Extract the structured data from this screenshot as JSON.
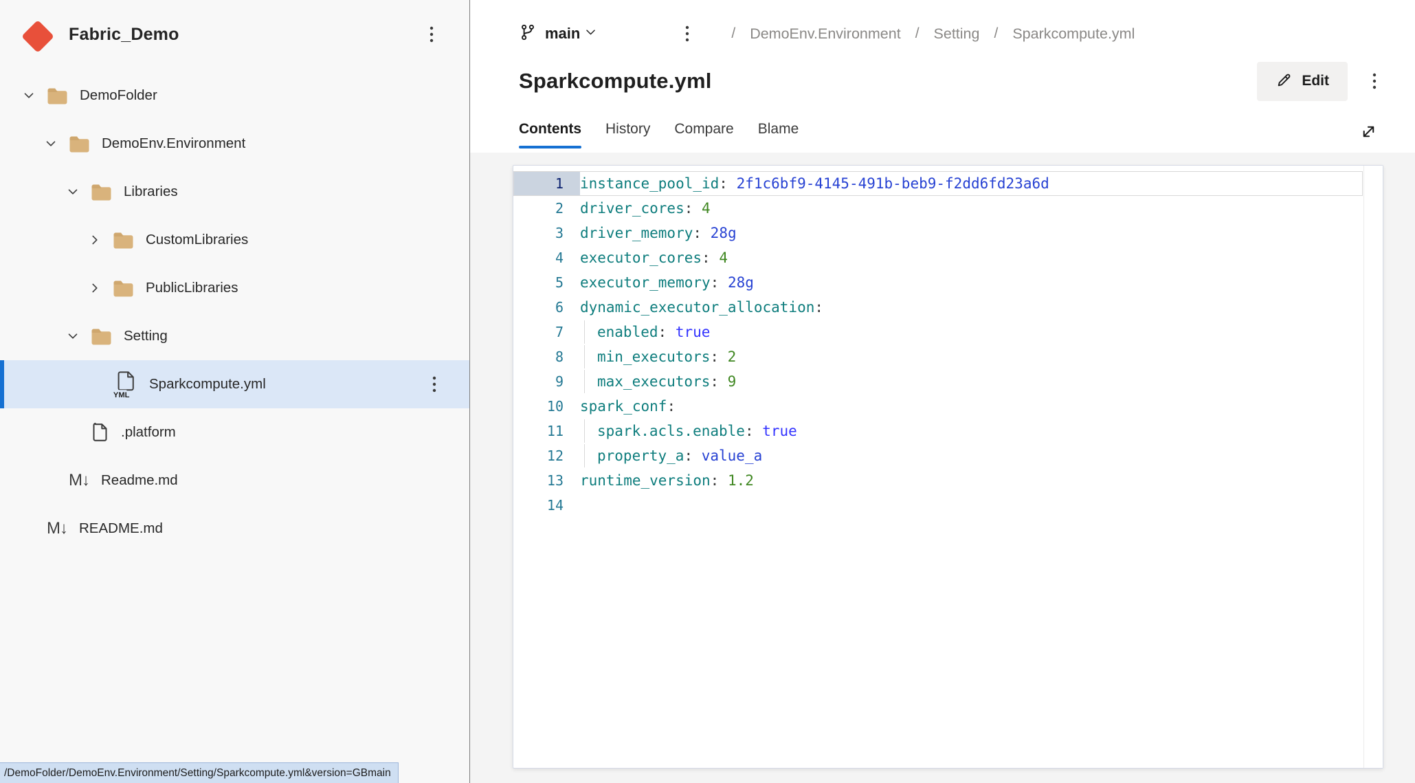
{
  "colors": {
    "accent_blue": "#1570d2",
    "selected_row_bg": "#dbe7f7",
    "selected_row_bar": "#1570cf",
    "repo_icon_red": "#e8503a",
    "folder_tan": "#d9b37c",
    "status_bar_bg": "#cfdff2",
    "token_key": "#0e7d7d",
    "token_string": "#2742d3",
    "token_boolean": "#3333ff",
    "token_number": "#3f8721",
    "token_default": "#3b3b3b",
    "line_number": "#237893",
    "line_number_active": "#0b216f"
  },
  "icons": {
    "repo": "git-fork",
    "branch": "git-branch",
    "kebab": "more-vertical",
    "chevron_down": "chevron-down",
    "chevron_right": "chevron-right",
    "chevron_small_down": "chevron-down-small",
    "folder": "folder",
    "yml_file": "yml-document",
    "md_file": "markdown-document",
    "md_glyph": "M↓",
    "file": "document",
    "edit": "pencil",
    "expand": "diagonal-resize"
  },
  "sidebar": {
    "repo_name": "Fabric_Demo",
    "tree": [
      {
        "label": "DemoFolder",
        "kind": "folder",
        "level": 0,
        "expanded": true
      },
      {
        "label": "DemoEnv.Environment",
        "kind": "folder",
        "level": 1,
        "expanded": true
      },
      {
        "label": "Libraries",
        "kind": "folder",
        "level": 2,
        "expanded": true
      },
      {
        "label": "CustomLibraries",
        "kind": "folder",
        "level": 3,
        "expanded": false
      },
      {
        "label": "PublicLibraries",
        "kind": "folder",
        "level": 3,
        "expanded": false
      },
      {
        "label": "Setting",
        "kind": "folder",
        "level": 2,
        "expanded": true
      },
      {
        "label": "Sparkcompute.yml",
        "kind": "yml-file",
        "level": 3,
        "selected": true,
        "kebab": true
      },
      {
        "label": ".platform",
        "kind": "file",
        "level": 2
      },
      {
        "label": "Readme.md",
        "kind": "md-file",
        "level": 1
      },
      {
        "label": "README.md",
        "kind": "md-file",
        "level": 0
      }
    ]
  },
  "topbar": {
    "branch": {
      "name": "main"
    },
    "breadcrumb": {
      "separator": "/",
      "segments": [
        "DemoEnv.Environment",
        "Setting",
        "Sparkcompute.yml"
      ]
    }
  },
  "file_header": {
    "title": "Sparkcompute.yml",
    "edit_label": "Edit"
  },
  "tabs": {
    "active": "Contents",
    "items": [
      "Contents",
      "History",
      "Compare",
      "Blame"
    ]
  },
  "code": {
    "language": "yaml",
    "lines": [
      {
        "n": 1,
        "current": true,
        "indent": 0,
        "tokens": [
          [
            "key",
            "instance_pool_id"
          ],
          [
            "default",
            ": "
          ],
          [
            "string",
            "2f1c6bf9-4145-491b-beb9-f2dd6fd23a6d"
          ]
        ]
      },
      {
        "n": 2,
        "indent": 0,
        "tokens": [
          [
            "key",
            "driver_cores"
          ],
          [
            "default",
            ": "
          ],
          [
            "number",
            "4"
          ]
        ]
      },
      {
        "n": 3,
        "indent": 0,
        "tokens": [
          [
            "key",
            "driver_memory"
          ],
          [
            "default",
            ": "
          ],
          [
            "string",
            "28g"
          ]
        ]
      },
      {
        "n": 4,
        "indent": 0,
        "tokens": [
          [
            "key",
            "executor_cores"
          ],
          [
            "default",
            ": "
          ],
          [
            "number",
            "4"
          ]
        ]
      },
      {
        "n": 5,
        "indent": 0,
        "tokens": [
          [
            "key",
            "executor_memory"
          ],
          [
            "default",
            ": "
          ],
          [
            "string",
            "28g"
          ]
        ]
      },
      {
        "n": 6,
        "indent": 0,
        "tokens": [
          [
            "key",
            "dynamic_executor_allocation"
          ],
          [
            "default",
            ":"
          ]
        ]
      },
      {
        "n": 7,
        "indent": 1,
        "tokens": [
          [
            "key",
            "enabled"
          ],
          [
            "default",
            ": "
          ],
          [
            "boolean",
            "true"
          ]
        ]
      },
      {
        "n": 8,
        "indent": 1,
        "tokens": [
          [
            "key",
            "min_executors"
          ],
          [
            "default",
            ": "
          ],
          [
            "number",
            "2"
          ]
        ]
      },
      {
        "n": 9,
        "indent": 1,
        "tokens": [
          [
            "key",
            "max_executors"
          ],
          [
            "default",
            ": "
          ],
          [
            "number",
            "9"
          ]
        ]
      },
      {
        "n": 10,
        "indent": 0,
        "tokens": [
          [
            "key",
            "spark_conf"
          ],
          [
            "default",
            ":"
          ]
        ]
      },
      {
        "n": 11,
        "indent": 1,
        "tokens": [
          [
            "key",
            "spark.acls.enable"
          ],
          [
            "default",
            ": "
          ],
          [
            "boolean",
            "true"
          ]
        ]
      },
      {
        "n": 12,
        "indent": 1,
        "tokens": [
          [
            "key",
            "property_a"
          ],
          [
            "default",
            ": "
          ],
          [
            "string",
            "value_a"
          ]
        ]
      },
      {
        "n": 13,
        "indent": 0,
        "tokens": [
          [
            "key",
            "runtime_version"
          ],
          [
            "default",
            ": "
          ],
          [
            "number",
            "1.2"
          ]
        ]
      },
      {
        "n": 14,
        "indent": 0,
        "tokens": []
      }
    ]
  },
  "status_bar": {
    "text": "/DemoFolder/DemoEnv.Environment/Setting/Sparkcompute.yml&version=GBmain"
  }
}
